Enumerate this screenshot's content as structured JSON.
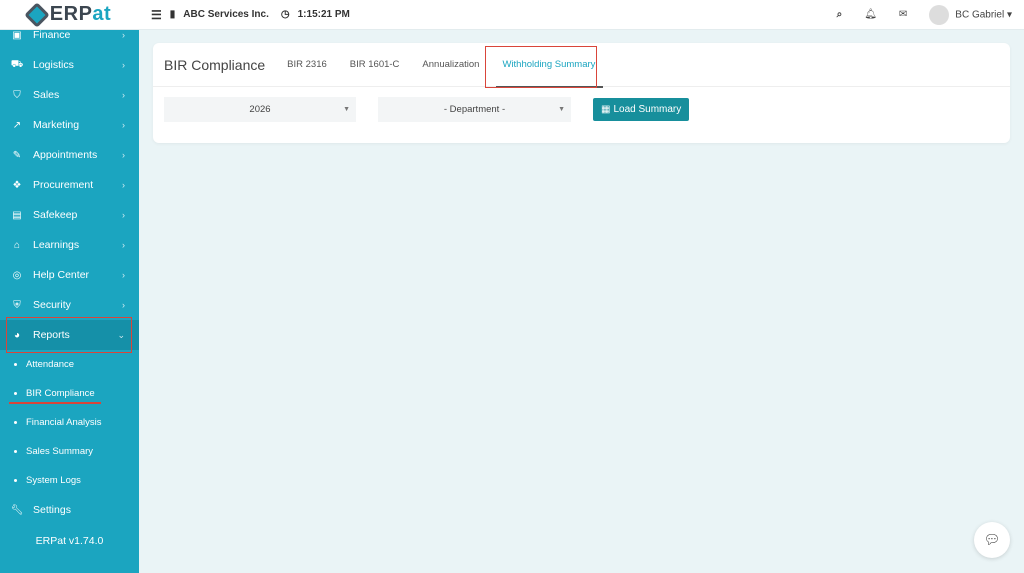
{
  "header": {
    "logo": "ERPat",
    "company": "ABC Services Inc.",
    "time": "1:15:21 PM",
    "user": "BC Gabriel"
  },
  "sidebar": {
    "items": [
      {
        "label": "Finance",
        "icon": "money-icon"
      },
      {
        "label": "Logistics",
        "icon": "truck-icon"
      },
      {
        "label": "Sales",
        "icon": "cart-icon"
      },
      {
        "label": "Marketing",
        "icon": "chart-line-icon"
      },
      {
        "label": "Appointments",
        "icon": "edit-icon"
      },
      {
        "label": "Procurement",
        "icon": "cubes-icon"
      },
      {
        "label": "Safekeep",
        "icon": "archive-icon"
      },
      {
        "label": "Learnings",
        "icon": "graduation-cap-icon"
      },
      {
        "label": "Help Center",
        "icon": "life-ring-icon"
      },
      {
        "label": "Security",
        "icon": "shield-icon"
      },
      {
        "label": "Reports",
        "icon": "pie-chart-icon"
      }
    ],
    "sub_items": [
      "Attendance",
      "BIR Compliance",
      "Financial Analysis",
      "Sales Summary",
      "System Logs"
    ],
    "settings": "Settings",
    "version": "ERPat v1.74.0"
  },
  "main": {
    "title": "BIR Compliance",
    "tabs": [
      "BIR 2316",
      "BIR 1601-C",
      "Annualization",
      "Withholding Summary"
    ],
    "active_tab": "Withholding Summary",
    "year": "2026",
    "department": "- Department -",
    "load_button": "Load Summary"
  }
}
